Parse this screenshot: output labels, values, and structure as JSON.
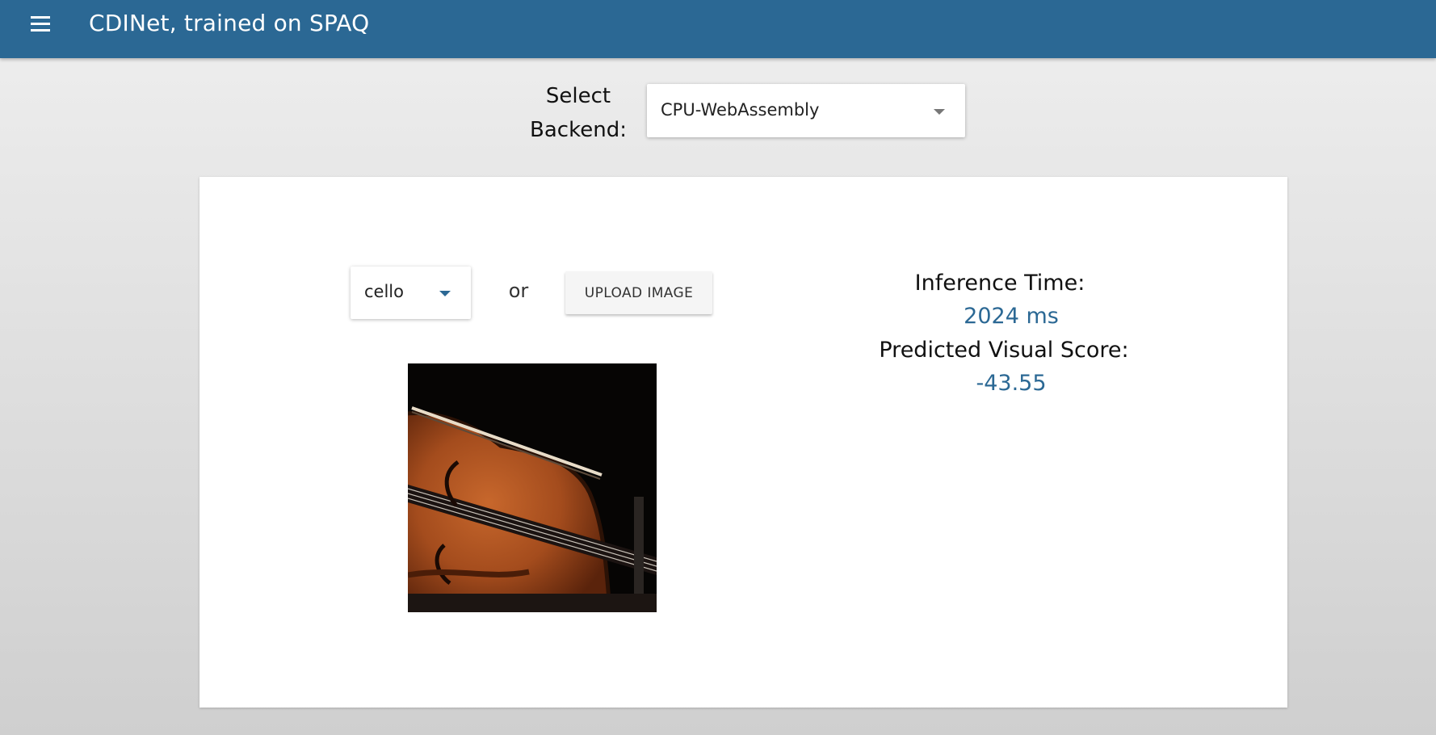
{
  "header": {
    "title": "CDINet, trained on SPAQ",
    "menu_icon": "hamburger-menu-icon",
    "background_color": "#2b6894"
  },
  "backend": {
    "label": "Select Backend:",
    "selected": "CPU-WebAssembly"
  },
  "input": {
    "selected_image": "cello",
    "or_text": "or",
    "upload_label": "UPLOAD IMAGE"
  },
  "results": {
    "inference_label": "Inference Time:",
    "inference_value": "2024 ms",
    "score_label": "Predicted Visual Score:",
    "score_value": "-43.55",
    "value_color": "#2b6894"
  }
}
